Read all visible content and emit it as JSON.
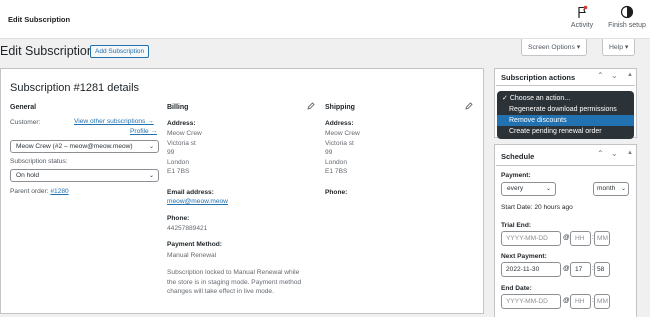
{
  "topbar": {
    "title": "Edit Subscription",
    "activity_label": "Activity",
    "finish_setup_label": "Finish setup"
  },
  "header": {
    "page_title": "Edit Subscription",
    "add_button": "Add Subscription",
    "screen_options": "Screen Options ▾",
    "help": "Help ▾"
  },
  "details": {
    "title": "Subscription #1281 details",
    "general": {
      "heading": "General",
      "customer_label": "Customer:",
      "view_other_link": "View other subscriptions →",
      "profile_link": "Profile →",
      "customer_value": "Meow Crew (#2 – meow@meow.meow)",
      "status_label": "Subscription status:",
      "status_value": "On hold",
      "parent_label": "Parent order:",
      "parent_link": "#1280"
    },
    "billing": {
      "heading": "Billing",
      "address_label": "Address:",
      "address_lines": [
        "Meow Crew",
        "Victoria st",
        "99",
        "London",
        "E1 7BS"
      ],
      "email_label": "Email address:",
      "email_value": "meow@meow.meow",
      "phone_label": "Phone:",
      "phone_value": "44257889421",
      "payment_label": "Payment Method:",
      "payment_value": "Manual Renewal",
      "note": [
        "Subscription locked to Manual Renewal while",
        "the store is in staging mode. Payment method",
        "changes will take effect in live mode."
      ]
    },
    "shipping": {
      "heading": "Shipping",
      "address_label": "Address:",
      "address_lines": [
        "Meow Crew",
        "Victoria st",
        "99",
        "London",
        "E1 7BS"
      ],
      "phone_label": "Phone:"
    }
  },
  "actions": {
    "title": "Subscription actions",
    "options": [
      "Choose an action...",
      "Regenerate download permissions",
      "Remove discounts",
      "Create pending renewal order"
    ],
    "checked_mark": "✓",
    "highlighted_index": 2
  },
  "schedule": {
    "title": "Schedule",
    "payment_label": "Payment:",
    "interval": "every",
    "period": "month",
    "start_date": "Start Date: 20 hours ago",
    "trial_label": "Trial End:",
    "trial_date_placeholder": "YYYY-MM-DD",
    "hh_placeholder": "HH",
    "mm_placeholder": "MM",
    "next_label": "Next Payment:",
    "next_date": "2022-11-30",
    "next_hh": "17",
    "next_mm": "58",
    "end_label": "End Date:",
    "end_date_placeholder": "YYYY-MM-DD",
    "at": "@"
  },
  "colors": {
    "accent": "#2271b1",
    "dropdown_bg": "#2c3338",
    "highlight": "#2271b1"
  }
}
